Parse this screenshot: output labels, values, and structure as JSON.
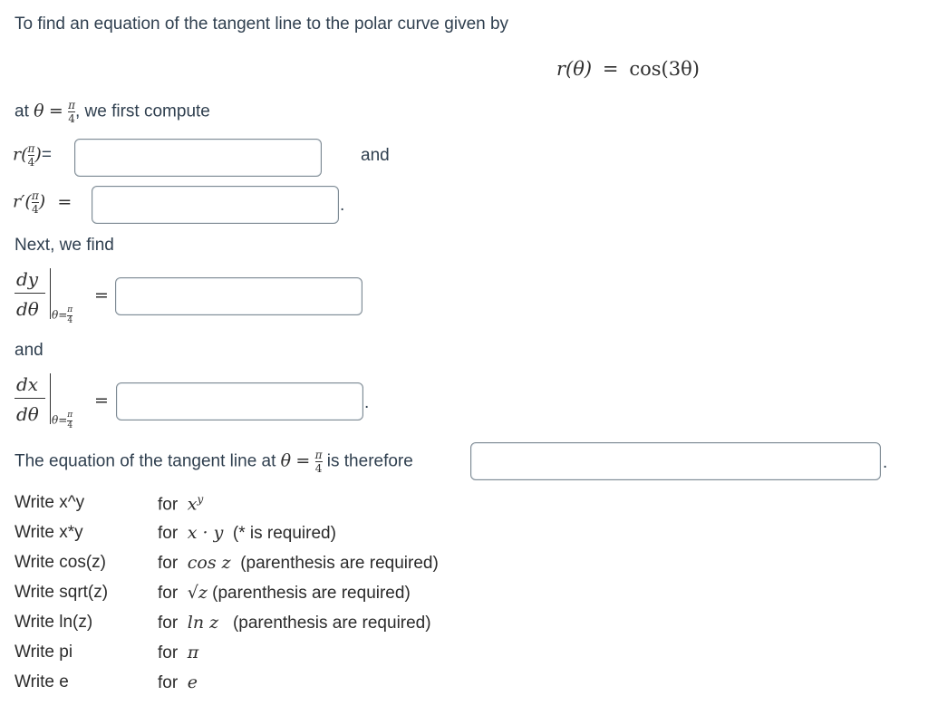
{
  "intro": "To find an equation of the tangent line to the polar curve given by",
  "equation": {
    "lhs": "r(θ)",
    "eq": "=",
    "rhs": "cos(3θ)"
  },
  "at_line": {
    "prefix": "at",
    "theta": "θ",
    "eq": "=",
    "pi": "π",
    "four": "4",
    "suffix": ", we first compute"
  },
  "r_row": {
    "label": "r(",
    "close": ")",
    "eq": "=",
    "and": "and",
    "value": ""
  },
  "rprime_row": {
    "label": "r′(",
    "close": ")",
    "eq": "=",
    "dot": ".",
    "value": ""
  },
  "next": "Next, we find",
  "dy_row": {
    "num": "dy",
    "den": "dθ",
    "sub_theta": "θ",
    "sub_eq": "=",
    "eq": "=",
    "value": ""
  },
  "and2": "and",
  "dx_row": {
    "num": "dx",
    "den": "dθ",
    "sub_theta": "θ",
    "sub_eq": "=",
    "eq": "=",
    "dot": ".",
    "value": ""
  },
  "tangent": {
    "prefix": "The equation of the tangent line at",
    "theta": "θ",
    "eq": "=",
    "suffix": "is therefore",
    "dot": ".",
    "value": ""
  },
  "help": [
    {
      "write": "Write x^y",
      "for": "for",
      "math": "x",
      "sup": "y",
      "note": ""
    },
    {
      "write": "Write x*y",
      "for": "for",
      "math": "x · y",
      "note": "(* is required)"
    },
    {
      "write": "Write cos(z)",
      "for": "for",
      "math": "cos z",
      "note": "(parenthesis are required)"
    },
    {
      "write": "Write sqrt(z)",
      "for": "for",
      "math": "√z",
      "note": "(parenthesis are required)"
    },
    {
      "write": "Write ln(z)",
      "for": "for",
      "math": "ln z",
      "note": "(parenthesis are required)"
    },
    {
      "write": "Write pi",
      "for": "for",
      "math": "π",
      "note": ""
    },
    {
      "write": "Write e",
      "for": "for",
      "math": "e",
      "note": ""
    }
  ]
}
